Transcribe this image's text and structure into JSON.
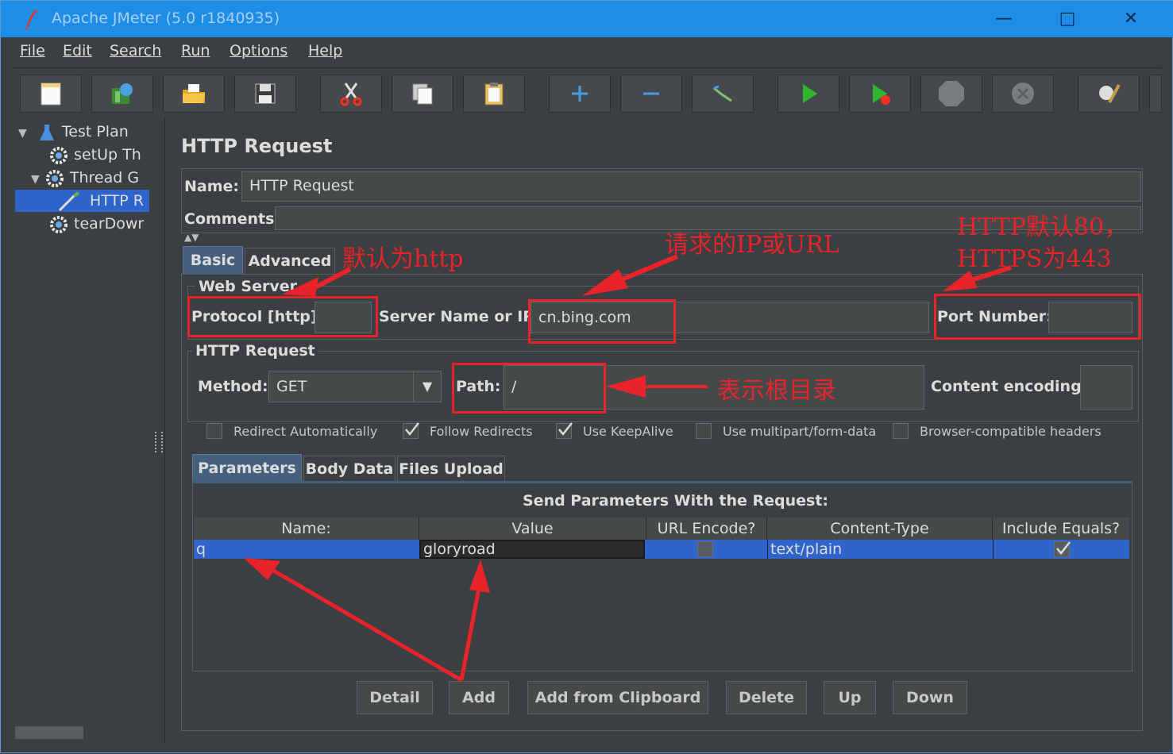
{
  "window": {
    "title": "Apache JMeter (5.0 r1840935)",
    "controls": [
      "minimize-icon",
      "maximize-icon",
      "close-icon"
    ]
  },
  "menu": [
    "File",
    "Edit",
    "Search",
    "Run",
    "Options",
    "Help"
  ],
  "toolbar_icons": [
    "new-icon",
    "templates-icon",
    "open-icon",
    "save-icon",
    "cut-icon",
    "copy-icon",
    "paste-icon",
    "expand-icon",
    "collapse-icon",
    "toggle-icon",
    "start-icon",
    "start-no-pauses-icon",
    "stop-icon",
    "shutdown-icon",
    "clear-icon"
  ],
  "tree": {
    "items": [
      {
        "label": "Test Plan",
        "icon": "flask-icon"
      },
      {
        "label": "setUp Th",
        "icon": "gear-icon"
      },
      {
        "label": "Thread G",
        "icon": "gear-icon"
      },
      {
        "label": "HTTP R",
        "icon": "pipette-icon"
      },
      {
        "label": "tearDowr",
        "icon": "gear-icon"
      }
    ]
  },
  "panel": {
    "title": "HTTP Request",
    "name_label": "Name:",
    "name_value": "HTTP Request",
    "comments_label": "Comments:",
    "tabs": [
      "Basic",
      "Advanced"
    ],
    "web_server": {
      "legend": "Web Server",
      "protocol_label": "Protocol [http]:",
      "protocol_value": "",
      "server_label": "Server Name or IP:",
      "server_value": "cn.bing.com",
      "port_label": "Port Number:",
      "port_value": ""
    },
    "http_request": {
      "legend": "HTTP Request",
      "method_label": "Method:",
      "method_value": "GET",
      "path_label": "Path:",
      "path_value": "/",
      "encoding_label": "Content encoding:",
      "encoding_value": ""
    },
    "checkboxes": [
      {
        "label": "Redirect Automatically",
        "checked": false
      },
      {
        "label": "Follow Redirects",
        "checked": true
      },
      {
        "label": "Use KeepAlive",
        "checked": true
      },
      {
        "label": "Use multipart/form-data",
        "checked": false
      },
      {
        "label": "Browser-compatible headers",
        "checked": false
      }
    ],
    "param_tabs": [
      "Parameters",
      "Body Data",
      "Files Upload"
    ],
    "params_title": "Send Parameters With the Request:",
    "columns": [
      "Name:",
      "Value",
      "URL Encode?",
      "Content-Type",
      "Include Equals?"
    ],
    "rows": [
      {
        "name": "q",
        "value": "gloryroad",
        "url_encode": false,
        "content_type": "text/plain",
        "include_equals": true
      }
    ],
    "buttons": [
      "Detail",
      "Add",
      "Add from Clipboard",
      "Delete",
      "Up",
      "Down"
    ]
  },
  "annotations": {
    "protocol": "默认为http",
    "server": "请求的IP或URL",
    "port_line1": "HTTP默认80，",
    "port_line2": "HTTPS为443",
    "path": "表示根目录"
  },
  "colors": {
    "title_bar": "#1e8de6",
    "background": "#3c3f41",
    "selection": "#2f65ca",
    "annotation": "#e8232a"
  }
}
